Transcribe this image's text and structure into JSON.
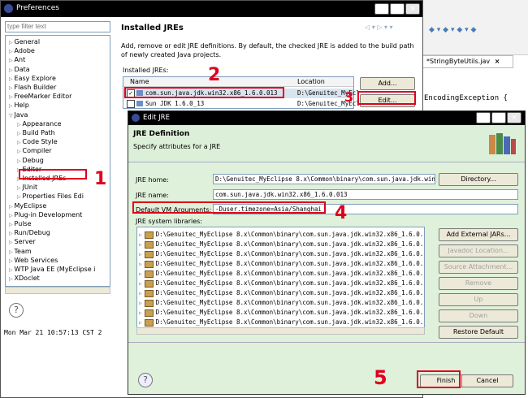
{
  "prefs": {
    "title": "Preferences",
    "filter_placeholder": "type filter text",
    "tree": [
      {
        "label": "General",
        "indent": 0
      },
      {
        "label": "Adobe",
        "indent": 0
      },
      {
        "label": "Ant",
        "indent": 0
      },
      {
        "label": "Data",
        "indent": 0
      },
      {
        "label": "Easy Explore",
        "indent": 0
      },
      {
        "label": "Flash Builder",
        "indent": 0
      },
      {
        "label": "FreeMarker Editor",
        "indent": 0
      },
      {
        "label": "Help",
        "indent": 0
      },
      {
        "label": "Java",
        "indent": 0
      },
      {
        "label": "Appearance",
        "indent": 1
      },
      {
        "label": "Build Path",
        "indent": 1
      },
      {
        "label": "Code Style",
        "indent": 1
      },
      {
        "label": "Compiler",
        "indent": 1
      },
      {
        "label": "Debug",
        "indent": 1
      },
      {
        "label": "Editor",
        "indent": 1
      },
      {
        "label": "Installed JREs",
        "indent": 1
      },
      {
        "label": "JUnit",
        "indent": 1
      },
      {
        "label": "Properties Files Edi",
        "indent": 1
      },
      {
        "label": "MyEclipse",
        "indent": 0
      },
      {
        "label": "Plug-in Development",
        "indent": 0
      },
      {
        "label": "Pulse",
        "indent": 0
      },
      {
        "label": "Run/Debug",
        "indent": 0
      },
      {
        "label": "Server",
        "indent": 0
      },
      {
        "label": "Team",
        "indent": 0
      },
      {
        "label": "Web Services",
        "indent": 0
      },
      {
        "label": "WTP Java EE (MyEclipse i",
        "indent": 0
      },
      {
        "label": "XDoclet",
        "indent": 0
      }
    ],
    "page_title": "Installed JREs",
    "description": "Add, remove or edit JRE definitions. By default, the checked JRE is added to the build path of newly created Java projects.",
    "installed_label": "Installed JREs:",
    "col_name": "Name",
    "col_location": "Location",
    "jres": [
      {
        "name": "com.sun.java.jdk.win32.x86_1.6.0.013",
        "location": "D:\\Genuitec_MyEcl"
      },
      {
        "name": "Sun JDK 1.6.0_13",
        "location": "D:\\Genuitec_MyEcli"
      }
    ],
    "add_label": "Add...",
    "edit_label": "Edit...",
    "help_icon": "?"
  },
  "background": {
    "tab_label": "*StringByteUtils.jav",
    "code_text": "EncodingException {",
    "console_text": "Mon Mar 21 10:57:13 CST 2"
  },
  "dialog": {
    "title": "Edit JRE",
    "header_title": "JRE Definition",
    "header_sub": "Specify attributes for a JRE",
    "jre_home_label": "JRE home:",
    "jre_home_value": "D:\\Genuitec_MyEclipse 8.x\\Common\\binary\\com.sun.java.jdk.win32.x86_",
    "directory_label": "Directory...",
    "jre_name_label": "JRE name:",
    "jre_name_value": "com.sun.java.jdk.win32.x86_1.6.0.013",
    "vm_args_label": "Default VM Arguments:",
    "vm_args_value": "-Duser.timezone=Asia/Shanghai",
    "libs_label": "JRE system libraries:",
    "libs": [
      "D:\\Genuitec_MyEclipse 8.x\\Common\\binary\\com.sun.java.jdk.win32.x86_1.6.0.",
      "D:\\Genuitec_MyEclipse 8.x\\Common\\binary\\com.sun.java.jdk.win32.x86_1.6.0.",
      "D:\\Genuitec_MyEclipse 8.x\\Common\\binary\\com.sun.java.jdk.win32.x86_1.6.0.",
      "D:\\Genuitec_MyEclipse 8.x\\Common\\binary\\com.sun.java.jdk.win32.x86_1.6.0.",
      "D:\\Genuitec_MyEclipse 8.x\\Common\\binary\\com.sun.java.jdk.win32.x86_1.6.0.",
      "D:\\Genuitec_MyEclipse 8.x\\Common\\binary\\com.sun.java.jdk.win32.x86_1.6.0.",
      "D:\\Genuitec_MyEclipse 8.x\\Common\\binary\\com.sun.java.jdk.win32.x86_1.6.0.",
      "D:\\Genuitec_MyEclipse 8.x\\Common\\binary\\com.sun.java.jdk.win32.x86_1.6.0.",
      "D:\\Genuitec_MyEclipse 8.x\\Common\\binary\\com.sun.java.jdk.win32.x86_1.6.0.",
      "D:\\Genuitec_MyEclipse 8.x\\Common\\binary\\com.sun.java.jdk.win32.x86_1.6.0."
    ],
    "add_external_jars": "Add External JARs...",
    "javadoc_location": "Javadoc Location...",
    "source_attachment": "Source Attachment...",
    "remove": "Remove",
    "up": "Up",
    "down": "Down",
    "restore_default": "Restore Default",
    "finish": "Finish",
    "cancel": "Cancel",
    "help_icon": "?"
  },
  "annotations": {
    "a1": "1",
    "a2": "2",
    "a3": "3",
    "a4": "4",
    "a5": "5"
  },
  "colors": {
    "title_bar": "#000000",
    "accent_red": "#e0001b",
    "header_green": "#dcefd8",
    "dialog_bg": "#dff0db",
    "selection": "#d8e4f0"
  }
}
